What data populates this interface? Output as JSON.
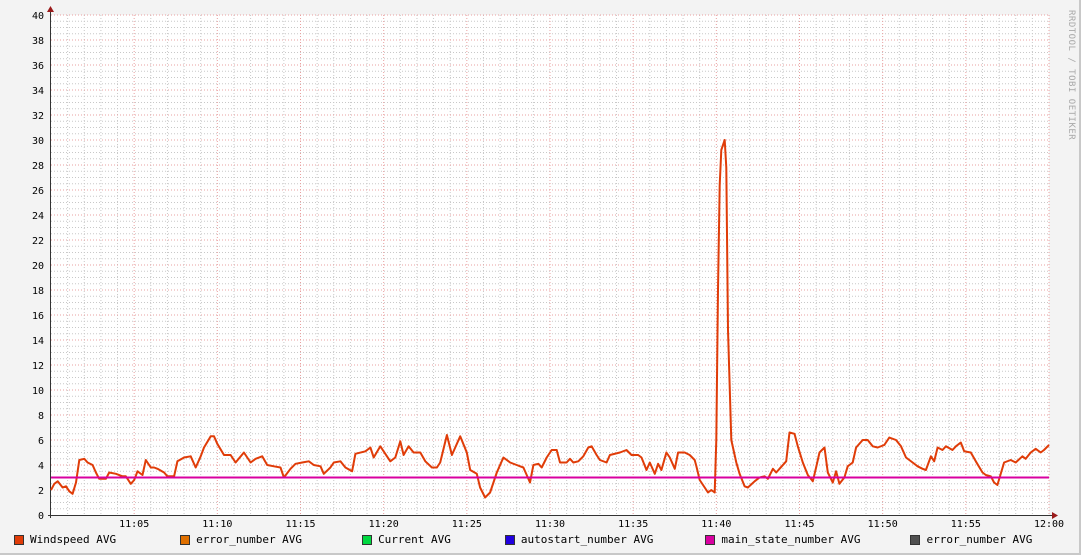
{
  "watermark": "RRDTOOL / TOBI OETIKER",
  "chart_data": {
    "type": "line",
    "title": "",
    "xlabel": "",
    "ylabel": "",
    "xlim_minutes": [
      0,
      60
    ],
    "ylim": [
      0,
      40
    ],
    "grid": true,
    "y_ticks": [
      "0",
      "2",
      "4",
      "6",
      "8",
      "10",
      "12",
      "14",
      "16",
      "18",
      "20",
      "22",
      "24",
      "26",
      "28",
      "30",
      "32",
      "34",
      "36",
      "38",
      "40"
    ],
    "x_ticks": [
      {
        "minute": 5,
        "label": "11:05"
      },
      {
        "minute": 10,
        "label": "11:10"
      },
      {
        "minute": 15,
        "label": "11:15"
      },
      {
        "minute": 20,
        "label": "11:20"
      },
      {
        "minute": 25,
        "label": "11:25"
      },
      {
        "minute": 30,
        "label": "11:30"
      },
      {
        "minute": 35,
        "label": "11:35"
      },
      {
        "minute": 40,
        "label": "11:40"
      },
      {
        "minute": 45,
        "label": "11:45"
      },
      {
        "minute": 50,
        "label": "11:50"
      },
      {
        "minute": 55,
        "label": "11:55"
      },
      {
        "minute": 60,
        "label": "12:00"
      }
    ],
    "legend_placement": "bottom",
    "series": [
      {
        "name": "Windspeed AVG",
        "color": "#e03c08",
        "x_unit": "minutes after 11:00",
        "points": [
          [
            0,
            2.0
          ],
          [
            0.2,
            2.5
          ],
          [
            0.4,
            2.7
          ],
          [
            0.7,
            2.2
          ],
          [
            0.9,
            2.3
          ],
          [
            1.1,
            1.9
          ],
          [
            1.3,
            1.7
          ],
          [
            1.5,
            2.6
          ],
          [
            1.7,
            4.4
          ],
          [
            2.0,
            4.5
          ],
          [
            2.2,
            4.2
          ],
          [
            2.5,
            4.0
          ],
          [
            2.7,
            3.4
          ],
          [
            2.9,
            2.9
          ],
          [
            3.3,
            2.9
          ],
          [
            3.5,
            3.4
          ],
          [
            3.9,
            3.3
          ],
          [
            4.3,
            3.1
          ],
          [
            4.5,
            3.1
          ],
          [
            4.8,
            2.5
          ],
          [
            5.0,
            2.8
          ],
          [
            5.2,
            3.5
          ],
          [
            5.5,
            3.2
          ],
          [
            5.7,
            4.4
          ],
          [
            6.0,
            3.8
          ],
          [
            6.2,
            3.8
          ],
          [
            6.4,
            3.7
          ],
          [
            6.8,
            3.4
          ],
          [
            7.0,
            3.1
          ],
          [
            7.4,
            3.1
          ],
          [
            7.6,
            4.3
          ],
          [
            8.0,
            4.6
          ],
          [
            8.4,
            4.7
          ],
          [
            8.7,
            3.8
          ],
          [
            9.0,
            4.7
          ],
          [
            9.2,
            5.4
          ],
          [
            9.6,
            6.3
          ],
          [
            9.8,
            6.3
          ],
          [
            10.0,
            5.7
          ],
          [
            10.4,
            4.8
          ],
          [
            10.8,
            4.8
          ],
          [
            11.1,
            4.2
          ],
          [
            11.6,
            5.0
          ],
          [
            12.0,
            4.2
          ],
          [
            12.3,
            4.5
          ],
          [
            12.7,
            4.7
          ],
          [
            13.0,
            4.0
          ],
          [
            13.4,
            3.9
          ],
          [
            13.8,
            3.8
          ],
          [
            14.0,
            3.0
          ],
          [
            14.4,
            3.7
          ],
          [
            14.7,
            4.1
          ],
          [
            15.1,
            4.2
          ],
          [
            15.5,
            4.3
          ],
          [
            15.8,
            4.0
          ],
          [
            16.2,
            3.9
          ],
          [
            16.4,
            3.3
          ],
          [
            16.8,
            3.8
          ],
          [
            17.0,
            4.2
          ],
          [
            17.4,
            4.3
          ],
          [
            17.7,
            3.8
          ],
          [
            18.1,
            3.5
          ],
          [
            18.3,
            4.9
          ],
          [
            18.9,
            5.1
          ],
          [
            19.2,
            5.4
          ],
          [
            19.4,
            4.6
          ],
          [
            19.8,
            5.5
          ],
          [
            20.1,
            4.9
          ],
          [
            20.4,
            4.3
          ],
          [
            20.7,
            4.6
          ],
          [
            21.0,
            5.9
          ],
          [
            21.2,
            4.8
          ],
          [
            21.5,
            5.5
          ],
          [
            21.8,
            5.0
          ],
          [
            22.2,
            5.0
          ],
          [
            22.5,
            4.3
          ],
          [
            22.9,
            3.8
          ],
          [
            23.2,
            3.8
          ],
          [
            23.4,
            4.2
          ],
          [
            23.8,
            6.4
          ],
          [
            24.1,
            4.8
          ],
          [
            24.6,
            6.3
          ],
          [
            25.0,
            5.0
          ],
          [
            25.2,
            3.6
          ],
          [
            25.6,
            3.3
          ],
          [
            25.8,
            2.2
          ],
          [
            26.1,
            1.4
          ],
          [
            26.4,
            1.8
          ],
          [
            26.8,
            3.4
          ],
          [
            27.0,
            4.0
          ],
          [
            27.2,
            4.6
          ],
          [
            27.6,
            4.2
          ],
          [
            28.0,
            4.0
          ],
          [
            28.2,
            3.9
          ],
          [
            28.4,
            3.8
          ],
          [
            28.8,
            2.6
          ],
          [
            29.0,
            4.0
          ],
          [
            29.3,
            4.1
          ],
          [
            29.5,
            3.8
          ],
          [
            29.8,
            4.6
          ],
          [
            30.1,
            5.2
          ],
          [
            30.4,
            5.2
          ],
          [
            30.6,
            4.2
          ],
          [
            31.0,
            4.2
          ],
          [
            31.2,
            4.5
          ],
          [
            31.4,
            4.2
          ],
          [
            31.7,
            4.3
          ],
          [
            32.0,
            4.7
          ],
          [
            32.3,
            5.4
          ],
          [
            32.5,
            5.5
          ],
          [
            32.8,
            4.8
          ],
          [
            33.0,
            4.4
          ],
          [
            33.4,
            4.2
          ],
          [
            33.6,
            4.8
          ],
          [
            34.2,
            5.0
          ],
          [
            34.6,
            5.2
          ],
          [
            34.9,
            4.8
          ],
          [
            35.3,
            4.8
          ],
          [
            35.5,
            4.6
          ],
          [
            35.8,
            3.6
          ],
          [
            36.0,
            4.2
          ],
          [
            36.3,
            3.3
          ],
          [
            36.5,
            4.1
          ],
          [
            36.7,
            3.6
          ],
          [
            37.0,
            5.0
          ],
          [
            37.2,
            4.6
          ],
          [
            37.5,
            3.7
          ],
          [
            37.7,
            5.0
          ],
          [
            38.1,
            5.0
          ],
          [
            38.4,
            4.8
          ],
          [
            38.7,
            4.4
          ],
          [
            38.8,
            3.9
          ],
          [
            39.0,
            2.8
          ],
          [
            39.3,
            2.2
          ],
          [
            39.5,
            1.8
          ],
          [
            39.7,
            2.0
          ],
          [
            39.9,
            1.8
          ],
          [
            40.0,
            6.0
          ],
          [
            40.1,
            18.0
          ],
          [
            40.2,
            26.4
          ],
          [
            40.3,
            29.2
          ],
          [
            40.5,
            30.0
          ],
          [
            40.6,
            27.8
          ],
          [
            40.7,
            14.8
          ],
          [
            40.9,
            6.0
          ],
          [
            41.2,
            4.2
          ],
          [
            41.4,
            3.3
          ],
          [
            41.7,
            2.3
          ],
          [
            41.9,
            2.2
          ],
          [
            42.3,
            2.7
          ],
          [
            42.6,
            3.0
          ],
          [
            42.9,
            3.1
          ],
          [
            43.1,
            2.9
          ],
          [
            43.4,
            3.7
          ],
          [
            43.6,
            3.4
          ],
          [
            43.8,
            3.7
          ],
          [
            44.2,
            4.3
          ],
          [
            44.4,
            6.6
          ],
          [
            44.7,
            6.5
          ],
          [
            44.9,
            5.5
          ],
          [
            45.2,
            4.2
          ],
          [
            45.5,
            3.2
          ],
          [
            45.8,
            2.7
          ],
          [
            46.0,
            3.8
          ],
          [
            46.2,
            5.0
          ],
          [
            46.5,
            5.4
          ],
          [
            46.7,
            3.4
          ],
          [
            47.0,
            2.6
          ],
          [
            47.2,
            3.5
          ],
          [
            47.4,
            2.5
          ],
          [
            47.7,
            3.0
          ],
          [
            47.9,
            3.9
          ],
          [
            48.2,
            4.2
          ],
          [
            48.4,
            5.4
          ],
          [
            48.8,
            6.0
          ],
          [
            49.1,
            6.0
          ],
          [
            49.4,
            5.5
          ],
          [
            49.7,
            5.4
          ],
          [
            50.1,
            5.6
          ],
          [
            50.4,
            6.2
          ],
          [
            50.8,
            6.0
          ],
          [
            51.1,
            5.5
          ],
          [
            51.4,
            4.6
          ],
          [
            51.8,
            4.2
          ],
          [
            52.1,
            3.9
          ],
          [
            52.4,
            3.7
          ],
          [
            52.6,
            3.6
          ],
          [
            52.9,
            4.7
          ],
          [
            53.1,
            4.3
          ],
          [
            53.3,
            5.4
          ],
          [
            53.6,
            5.2
          ],
          [
            53.8,
            5.5
          ],
          [
            54.2,
            5.2
          ],
          [
            54.4,
            5.5
          ],
          [
            54.7,
            5.8
          ],
          [
            54.9,
            5.1
          ],
          [
            55.3,
            5.0
          ],
          [
            55.6,
            4.3
          ],
          [
            56.0,
            3.4
          ],
          [
            56.2,
            3.2
          ],
          [
            56.5,
            3.1
          ],
          [
            56.7,
            2.6
          ],
          [
            56.9,
            2.4
          ],
          [
            57.3,
            4.2
          ],
          [
            57.7,
            4.4
          ],
          [
            58.0,
            4.2
          ],
          [
            58.4,
            4.7
          ],
          [
            58.6,
            4.5
          ],
          [
            58.9,
            5.0
          ],
          [
            59.2,
            5.3
          ],
          [
            59.5,
            5.0
          ],
          [
            59.7,
            5.2
          ],
          [
            60.0,
            5.6
          ]
        ]
      },
      {
        "name": "error_number AVG",
        "color": "#e07000",
        "points": []
      },
      {
        "name": "Current AVG",
        "color": "#00d840",
        "points": []
      },
      {
        "name": "autostart_number AVG",
        "color": "#2000e0",
        "points": []
      },
      {
        "name": "main_state_number AVG",
        "color": "#d800a0",
        "points": [
          [
            0,
            3
          ],
          [
            60,
            3
          ]
        ]
      },
      {
        "name": "error_number AVG",
        "color": "#505050",
        "points": []
      }
    ]
  }
}
